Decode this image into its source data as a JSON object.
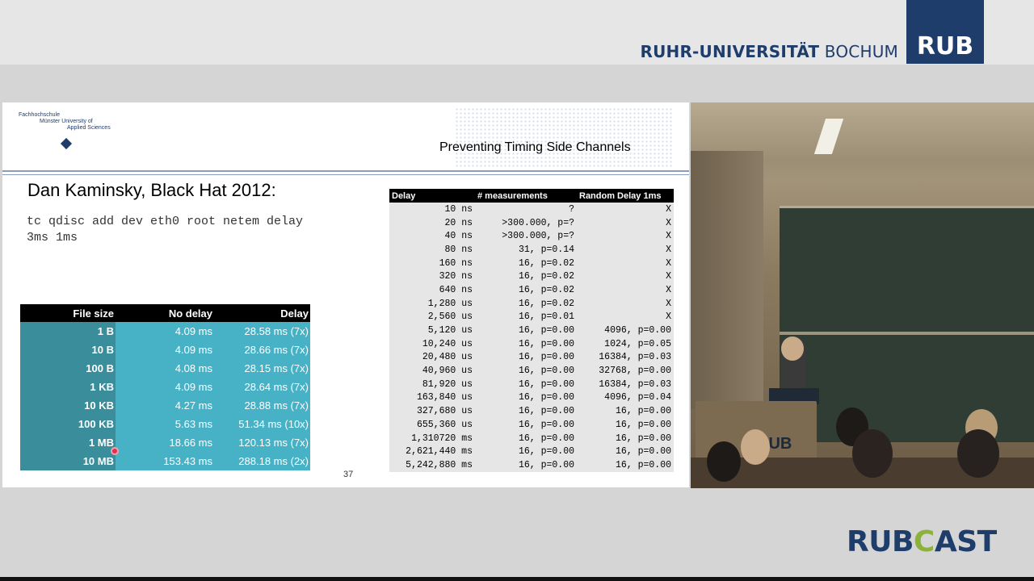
{
  "header": {
    "university_bold": "RUHR-UNIVERSITÄT",
    "university_regular": "BOCHUM",
    "logo_text": "RUB"
  },
  "slide": {
    "institution_logo_lines": [
      "Fachhochschule",
      "Münster University of",
      "Applied Sciences"
    ],
    "title": "Preventing Timing Side Channels",
    "heading": "Dan Kaminsky, Black Hat 2012:",
    "command": "tc qdisc add dev eth0 root netem delay\n3ms 1ms",
    "page_number": "37",
    "file_table": {
      "headers": [
        "File size",
        "No delay",
        "Delay"
      ],
      "rows": [
        [
          "1 B",
          "4.09 ms",
          "28.58 ms (7x)"
        ],
        [
          "10 B",
          "4.09 ms",
          "28.66 ms (7x)"
        ],
        [
          "100 B",
          "4.08 ms",
          "28.15 ms (7x)"
        ],
        [
          "1 KB",
          "4.09 ms",
          "28.64 ms (7x)"
        ],
        [
          "10 KB",
          "4.27 ms",
          "28.88 ms (7x)"
        ],
        [
          "100 KB",
          "5.63 ms",
          "51.34 ms (10x)"
        ],
        [
          "1 MB",
          "18.66 ms",
          "120.13 ms (7x)"
        ],
        [
          "10 MB",
          "153.43 ms",
          "288.18 ms (2x)"
        ]
      ]
    },
    "delay_table": {
      "headers": [
        "Delay",
        "# measurements",
        "Random Delay 1ms"
      ],
      "rows": [
        [
          "10 ns",
          "?",
          "X"
        ],
        [
          "20 ns",
          ">300.000, p=?",
          "X"
        ],
        [
          "40 ns",
          ">300.000, p=?",
          "X"
        ],
        [
          "80 ns",
          "31, p=0.14",
          "X"
        ],
        [
          "160 ns",
          "16, p=0.02",
          "X"
        ],
        [
          "320 ns",
          "16, p=0.02",
          "X"
        ],
        [
          "640 ns",
          "16, p=0.02",
          "X"
        ],
        [
          "1,280 us",
          "16, p=0.02",
          "X"
        ],
        [
          "2,560 us",
          "16, p=0.01",
          "X"
        ],
        [
          "5,120 us",
          "16, p=0.00",
          "4096, p=0.00"
        ],
        [
          "10,240 us",
          "16, p=0.00",
          "1024, p=0.05"
        ],
        [
          "20,480 us",
          "16, p=0.00",
          "16384, p=0.03"
        ],
        [
          "40,960 us",
          "16, p=0.00",
          "32768, p=0.00"
        ],
        [
          "81,920 us",
          "16, p=0.00",
          "16384, p=0.03"
        ],
        [
          "163,840 us",
          "16, p=0.00",
          "4096, p=0.04"
        ],
        [
          "327,680 us",
          "16, p=0.00",
          "16, p=0.00"
        ],
        [
          "655,360 us",
          "16, p=0.00",
          "16, p=0.00"
        ],
        [
          "1,310720 ms",
          "16, p=0.00",
          "16, p=0.00"
        ],
        [
          "2,621,440 ms",
          "16, p=0.00",
          "16, p=0.00"
        ],
        [
          "5,242,880 ms",
          "16, p=0.00",
          "16, p=0.00"
        ]
      ]
    }
  },
  "video": {
    "desk_logo": "RUB"
  },
  "footer": {
    "brand_left": "RUB",
    "brand_c": "C",
    "brand_right": "AST"
  }
}
